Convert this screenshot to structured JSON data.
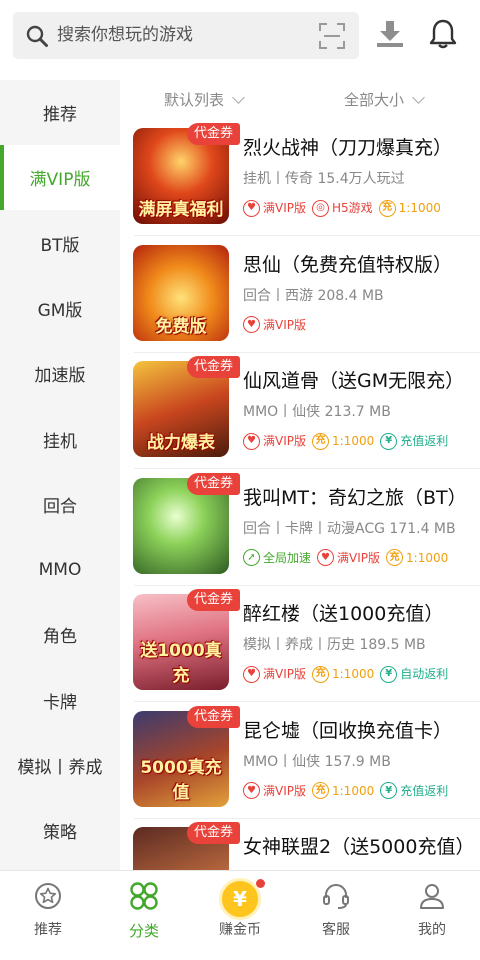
{
  "search": {
    "placeholder": "搜索你想玩的游戏",
    "icons": [
      "search-icon",
      "scan-icon"
    ]
  },
  "header_icons": [
    "download-icon",
    "bell-icon"
  ],
  "sidebar": {
    "active": 1,
    "items": [
      {
        "label": "推荐"
      },
      {
        "label": "满VIP版"
      },
      {
        "label": "BT版"
      },
      {
        "label": "GM版"
      },
      {
        "label": "加速版"
      },
      {
        "label": "挂机"
      },
      {
        "label": "回合"
      },
      {
        "label": "MMO"
      },
      {
        "label": "角色"
      },
      {
        "label": "卡牌"
      },
      {
        "label": "模拟丨养成"
      },
      {
        "label": "策略"
      }
    ]
  },
  "filters": {
    "sort": "默认列表",
    "size": "全部大小"
  },
  "voucher_label": "代金券",
  "games": [
    {
      "title": "烈火战神（刀刀爆真充）",
      "meta": "挂机丨传奇 15.4万人玩过",
      "voucher": true,
      "thumb_caption": "满屏真福利",
      "tags": [
        {
          "type": "vip",
          "label": "满VIP版"
        },
        {
          "type": "h5",
          "label": "H5游戏"
        },
        {
          "type": "coin",
          "label": "1:1000"
        }
      ]
    },
    {
      "title": "思仙（免费充值特权版）",
      "meta": "回合丨西游 208.4 MB",
      "voucher": false,
      "thumb_caption": "免费版",
      "tags": [
        {
          "type": "vip",
          "label": "满VIP版"
        }
      ]
    },
    {
      "title": "仙风道骨（送GM无限充）",
      "meta": "MMO丨仙侠 213.7 MB",
      "voucher": true,
      "thumb_caption": "战力爆表",
      "tags": [
        {
          "type": "vip",
          "label": "满VIP版"
        },
        {
          "type": "coin",
          "label": "1:1000"
        },
        {
          "type": "ret",
          "label": "充值返利"
        }
      ]
    },
    {
      "title": "我叫MT：奇幻之旅（BT）",
      "meta": "回合丨卡牌丨动漫ACG 171.4 MB",
      "voucher": true,
      "thumb_caption": "",
      "tags": [
        {
          "type": "speed",
          "label": "全局加速"
        },
        {
          "type": "vip",
          "label": "满VIP版"
        },
        {
          "type": "coin",
          "label": "1:1000"
        }
      ]
    },
    {
      "title": "醉红楼（送1000充值）",
      "meta": "模拟丨养成丨历史 189.5 MB",
      "voucher": true,
      "thumb_caption": "送1000真充",
      "tags": [
        {
          "type": "vip",
          "label": "满VIP版"
        },
        {
          "type": "coin",
          "label": "1:1000"
        },
        {
          "type": "ret",
          "label": "自动返利"
        }
      ]
    },
    {
      "title": "昆仑墟（回收换充值卡）",
      "meta": "MMO丨仙侠 157.9 MB",
      "voucher": true,
      "thumb_caption": "5000真充值",
      "tags": [
        {
          "type": "vip",
          "label": "满VIP版"
        },
        {
          "type": "coin",
          "label": "1:1000"
        },
        {
          "type": "ret",
          "label": "充值返利"
        }
      ]
    },
    {
      "title": "女神联盟2（送5000充值）",
      "meta": "",
      "voucher": true,
      "thumb_caption": "",
      "tags": []
    }
  ],
  "bottom_nav": {
    "active": 1,
    "items": [
      {
        "label": "推荐",
        "icon": "star-icon"
      },
      {
        "label": "分类",
        "icon": "category-icon"
      },
      {
        "label": "赚金币",
        "icon": "coin-icon"
      },
      {
        "label": "客服",
        "icon": "headset-icon"
      },
      {
        "label": "我的",
        "icon": "user-icon"
      }
    ]
  },
  "colors": {
    "accent": "#44a82c",
    "voucher": "#e8423a",
    "coin": "#f0a010",
    "rebate": "#1eae8a"
  }
}
